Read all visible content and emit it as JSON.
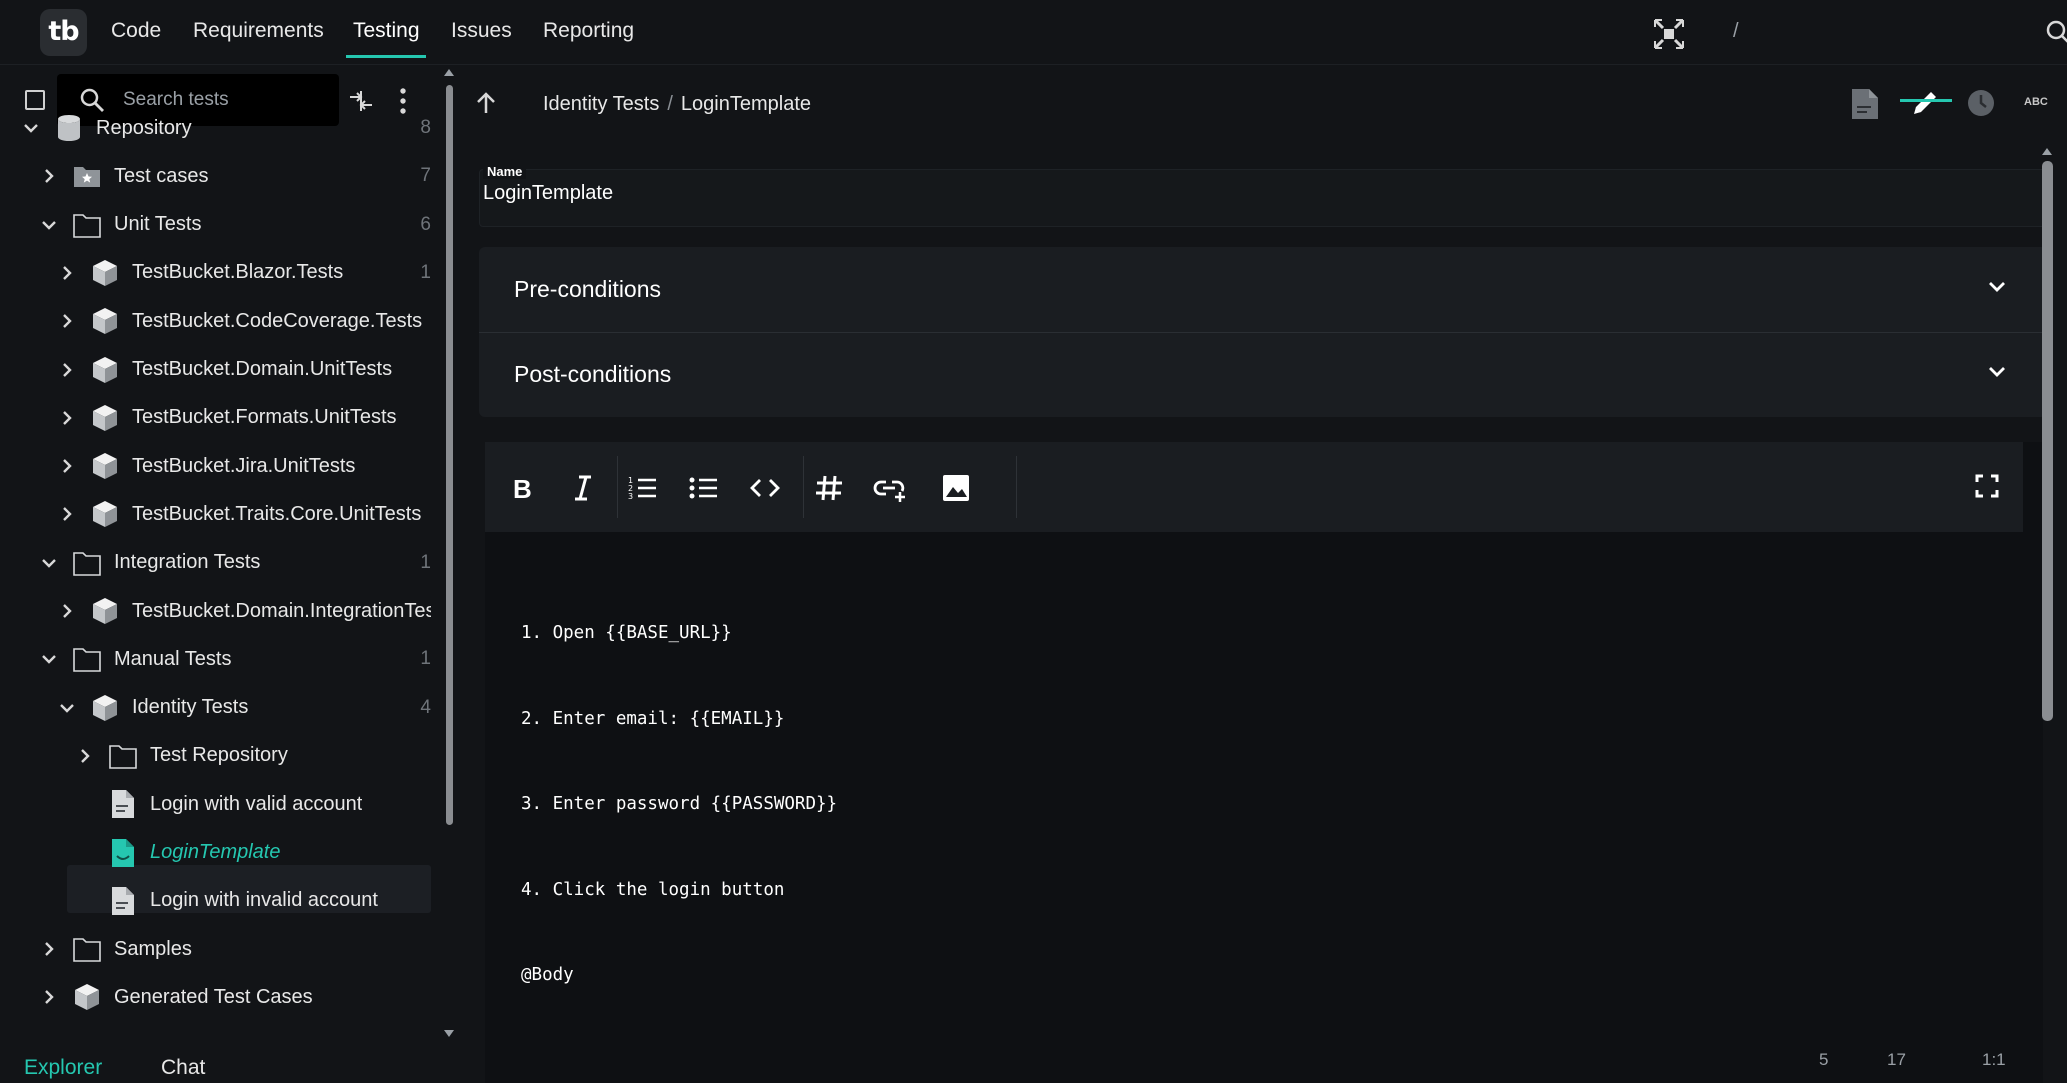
{
  "app": {
    "logo_text": "tb",
    "accent_color": "#25c7b0"
  },
  "top_nav": {
    "items": [
      {
        "label": "Code"
      },
      {
        "label": "Requirements"
      },
      {
        "label": "Testing"
      },
      {
        "label": "Issues"
      },
      {
        "label": "Reporting"
      }
    ],
    "active": "Testing",
    "slash": "/",
    "right_icons": [
      "focus-icon",
      "search-icon"
    ]
  },
  "sidebar": {
    "search": {
      "placeholder": "Search tests",
      "value": ""
    },
    "tree": [
      {
        "label": "Repository",
        "count": "8",
        "icon": "database-icon",
        "expanded": true
      },
      {
        "label": "Test cases",
        "count": "7",
        "icon": "star-folder-icon",
        "expanded": false
      },
      {
        "label": "Unit Tests",
        "count": "6",
        "icon": "folder-icon",
        "expanded": true
      },
      {
        "label": "TestBucket.Blazor.Tests",
        "count": "1",
        "icon": "cube-icon",
        "expanded": false
      },
      {
        "label": "TestBucket.CodeCoverage.Tests",
        "count": "",
        "icon": "cube-icon",
        "expanded": false
      },
      {
        "label": "TestBucket.Domain.UnitTests",
        "count": "",
        "icon": "cube-icon",
        "expanded": false
      },
      {
        "label": "TestBucket.Formats.UnitTests",
        "count": "",
        "icon": "cube-icon",
        "expanded": false
      },
      {
        "label": "TestBucket.Jira.UnitTests",
        "count": "",
        "icon": "cube-icon",
        "expanded": false
      },
      {
        "label": "TestBucket.Traits.Core.UnitTests",
        "count": "",
        "icon": "cube-icon",
        "expanded": false
      },
      {
        "label": "Integration Tests",
        "count": "1",
        "icon": "folder-icon",
        "expanded": true
      },
      {
        "label": "TestBucket.Domain.IntegrationTests",
        "count": "",
        "icon": "cube-icon",
        "expanded": false
      },
      {
        "label": "Manual Tests",
        "count": "1",
        "icon": "folder-icon",
        "expanded": true
      },
      {
        "label": "Identity Tests",
        "count": "4",
        "icon": "cube-icon",
        "expanded": true
      },
      {
        "label": "Test Repository",
        "count": "",
        "icon": "folder-icon",
        "expanded": false
      },
      {
        "label": "Login with valid account",
        "count": "",
        "icon": "document-icon"
      },
      {
        "label": "LoginTemplate",
        "count": "",
        "icon": "template-icon",
        "selected": true
      },
      {
        "label": "Login with invalid account",
        "count": "",
        "icon": "document-icon"
      },
      {
        "label": "Samples",
        "count": "",
        "icon": "folder-icon",
        "expanded": false
      },
      {
        "label": "Generated Test Cases",
        "count": "",
        "icon": "cube-icon",
        "expanded": false
      }
    ],
    "tabs": [
      {
        "label": "Explorer",
        "active": true
      },
      {
        "label": "Chat",
        "active": false
      }
    ]
  },
  "main": {
    "breadcrumb": {
      "parent": "Identity Tests",
      "separator": "/",
      "current": "LoginTemplate"
    },
    "view_icons": [
      "document-icon",
      "edit-icon",
      "history-icon",
      "spellcheck-icon"
    ],
    "view_icon_text": "ABC",
    "name_field": {
      "label": "Name",
      "value": "LoginTemplate"
    },
    "sections": [
      {
        "label": "Pre-conditions"
      },
      {
        "label": "Post-conditions"
      }
    ],
    "editor": {
      "toolbar": [
        "bold-icon",
        "italic-icon",
        "numbered-list-icon",
        "bullet-list-icon",
        "code-icon",
        "hashtag-icon",
        "insert-link-icon",
        "image-icon",
        "fullscreen-icon"
      ],
      "lines": [
        "1. Open {{BASE_URL}}",
        "2. Enter email: {{EMAIL}}",
        "3. Enter password {{PASSWORD}}",
        "4. Click the login button",
        "@Body"
      ]
    },
    "status": {
      "lines": "5",
      "words": "17",
      "position": "1:1"
    }
  }
}
